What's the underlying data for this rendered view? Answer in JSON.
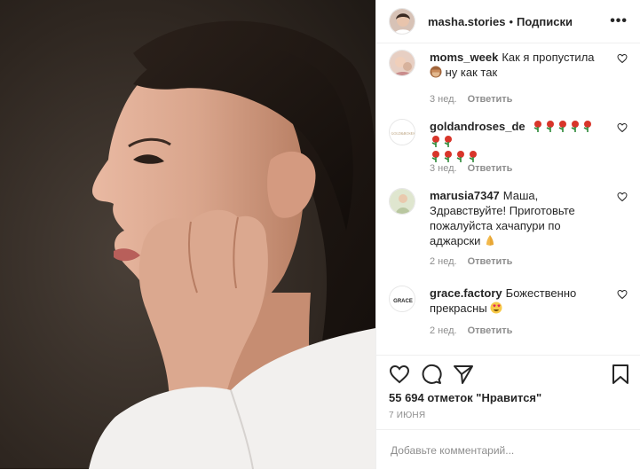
{
  "header": {
    "username": "masha.stories",
    "separator": "•",
    "follow_label": "Подписки",
    "more_icon": "more-dots-icon"
  },
  "comments": [
    {
      "username": "moms_week",
      "text": "Как я пропустила",
      "text2": "ну как так",
      "emoji": "see-no-evil-monkey-emoji",
      "time": "3 нед.",
      "reply": "Ответить"
    },
    {
      "username": "goldandroses_de",
      "emoji": "rose-emoji",
      "time": "3 нед.",
      "reply": "Ответить"
    },
    {
      "username": "marusia7347",
      "text": "Маша, Здравствуйте! Приготовьте пожалуйста хачапури по аджарски",
      "emoji": "folded-hands-emoji",
      "time": "2 нед.",
      "reply": "Ответить"
    },
    {
      "username": "grace.factory",
      "text": "Божественно прекрасны",
      "emoji": "heart-eyes-emoji",
      "avatar_text": "GRACE",
      "time": "2 нед.",
      "reply": "Ответить"
    }
  ],
  "post": {
    "likes": "55 694 отметок \"Нравится\"",
    "date": "7 ИЮНЯ"
  },
  "add_comment": {
    "placeholder": "Добавьте комментарий..."
  },
  "colors": {
    "text": "#262626",
    "meta": "#8e8e8e",
    "border": "#efefef",
    "rose": "#d8352a"
  }
}
